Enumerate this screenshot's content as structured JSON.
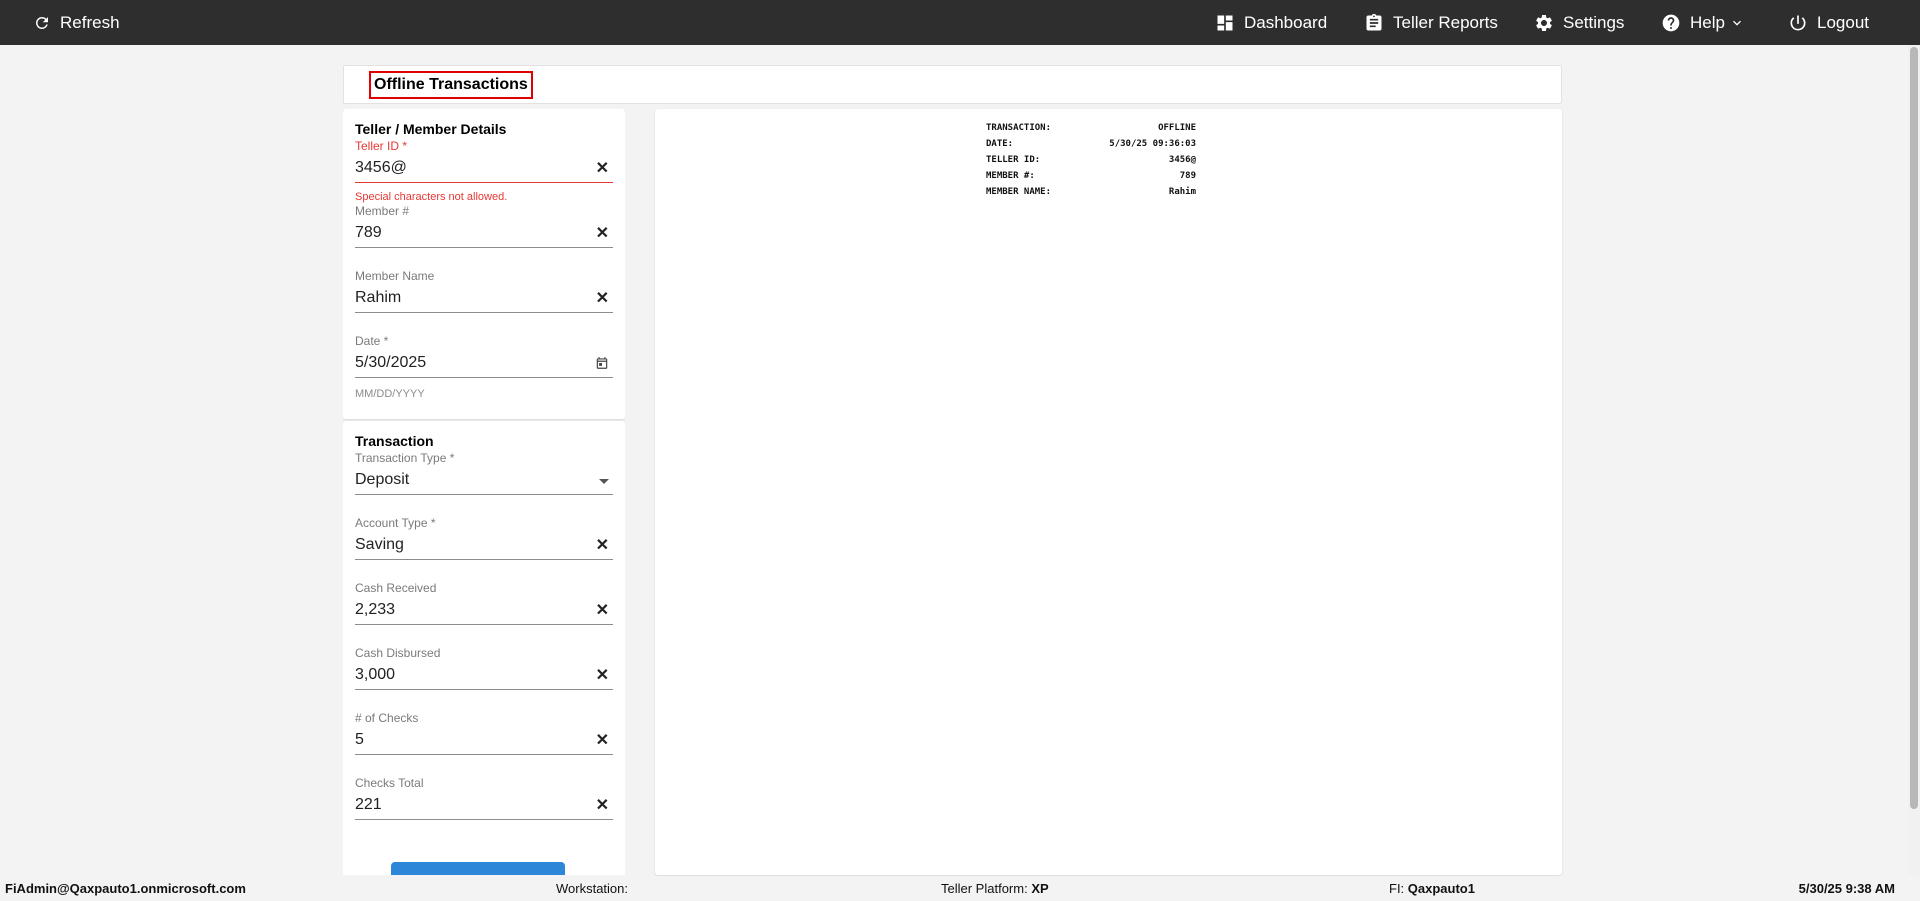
{
  "topbar": {
    "refresh_label": "Refresh",
    "dashboard_label": "Dashboard",
    "reports_label": "Teller Reports",
    "settings_label": "Settings",
    "help_label": "Help",
    "logout_label": "Logout"
  },
  "page": {
    "title": "Offline Transactions"
  },
  "teller_member": {
    "heading": "Teller / Member Details",
    "teller_id": {
      "label": "Teller ID *",
      "value": "3456@",
      "error": "Special characters not allowed."
    },
    "member_number": {
      "label": "Member #",
      "value": "789"
    },
    "member_name": {
      "label": "Member Name",
      "value": "Rahim"
    },
    "date": {
      "label": "Date *",
      "value": "5/30/2025",
      "helper": "MM/DD/YYYY"
    }
  },
  "transaction": {
    "heading": "Transaction",
    "type": {
      "label": "Transaction Type *",
      "value": "Deposit"
    },
    "account_type": {
      "label": "Account Type *",
      "value": "Saving"
    },
    "cash_received": {
      "label": "Cash Received",
      "value": "2,233"
    },
    "cash_disbursed": {
      "label": "Cash Disbursed",
      "value": "3,000"
    },
    "num_checks": {
      "label": "# of Checks",
      "value": "5"
    },
    "checks_total": {
      "label": "Checks Total",
      "value": "221"
    }
  },
  "receipt": {
    "rows": [
      {
        "key": "TRANSACTION:",
        "value": "OFFLINE"
      },
      {
        "key": "DATE:",
        "value": "5/30/25 09:36:03"
      },
      {
        "key": "TELLER ID:",
        "value": "3456@"
      },
      {
        "key": "MEMBER #:",
        "value": "789"
      },
      {
        "key": "MEMBER NAME:",
        "value": "Rahim"
      }
    ]
  },
  "footer": {
    "user": "FiAdmin@Qaxpauto1.onmicrosoft.com",
    "workstation_label": "Workstation:",
    "workstation_value": "",
    "platform_label": "Teller Platform:",
    "platform_value": "XP",
    "fi_label": "FI:",
    "fi_value": "Qaxpauto1",
    "datetime": "5/30/25 9:38 AM"
  },
  "colors": {
    "topbar": "#2e2e2e",
    "error": "#e53935",
    "title_highlight": "#e00000",
    "primary": "#2e86d9"
  }
}
